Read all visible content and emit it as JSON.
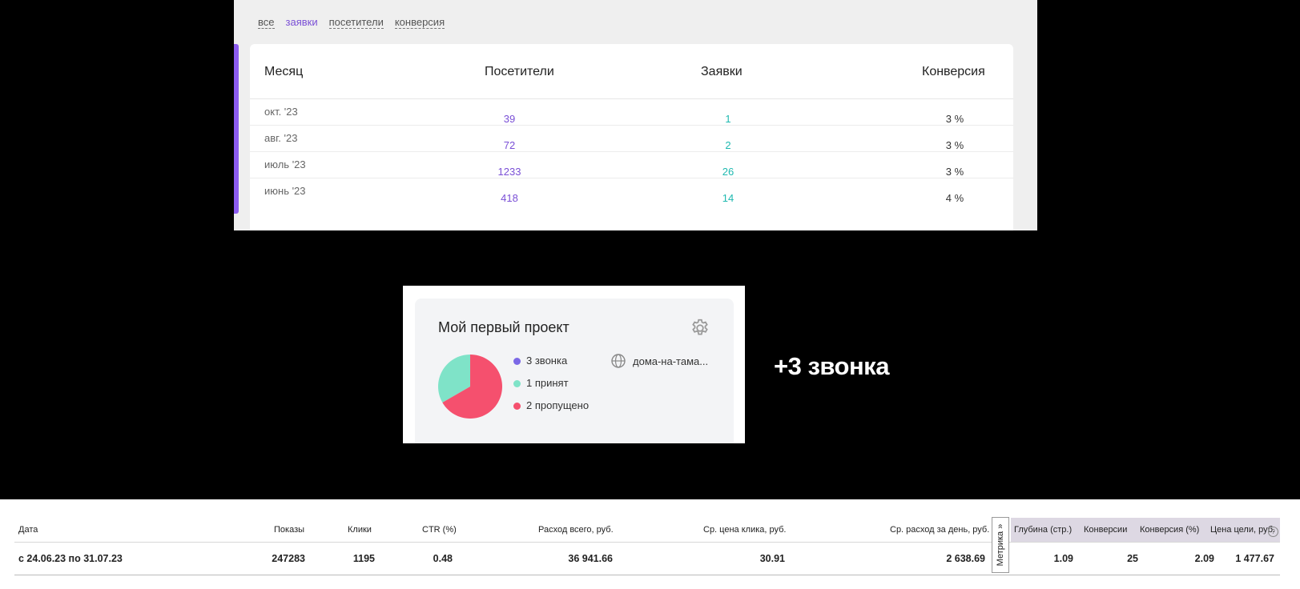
{
  "filters": [
    "все",
    "заявки",
    "посетители",
    "конверсия"
  ],
  "table": {
    "headers": {
      "month": "Месяц",
      "visitors": "Посетители",
      "applications": "Заявки",
      "conversion": "Конверсия"
    },
    "rows": [
      {
        "month": "окт. '23",
        "visitors": "39",
        "applications": "1",
        "conversion": "3 %"
      },
      {
        "month": "авг. '23",
        "visitors": "72",
        "applications": "2",
        "conversion": "3 %"
      },
      {
        "month": "июль '23",
        "visitors": "1233",
        "applications": "26",
        "conversion": "3 %"
      },
      {
        "month": "июнь '23",
        "visitors": "418",
        "applications": "14",
        "conversion": "4 %"
      }
    ]
  },
  "project": {
    "title": "Мой первый проект",
    "legend": [
      {
        "label": "3 звонка",
        "color": "#7b68e6"
      },
      {
        "label": "1 принят",
        "color": "#7fe3c8"
      },
      {
        "label": "2 пропущено",
        "color": "#f5506e"
      }
    ],
    "pie": {
      "accepted": 1,
      "missed": 2
    },
    "site": "дома-на-тама..."
  },
  "headline": "+3 звонка",
  "stats": {
    "headers": {
      "date": "Дата",
      "impressions": "Показы",
      "clicks": "Клики",
      "ctr": "CTR (%)",
      "spend": "Расход всего, руб.",
      "cpc": "Ср. цена клика, руб.",
      "daily": "Ср. расход за день, руб.",
      "depth": "Глубина (стр.)",
      "conversions": "Конверсии",
      "conv_rate": "Конверсия (%)",
      "goal_price": "Цена цели, руб."
    },
    "metrika": "Метрика »",
    "row": {
      "date": "с 24.06.23 по 31.07.23",
      "impressions": "247283",
      "clicks": "1195",
      "ctr": "0.48",
      "spend": "36 941.66",
      "cpc": "30.91",
      "daily": "2 638.69",
      "depth": "1.09",
      "conversions": "25",
      "conv_rate": "2.09",
      "goal_price": "1 477.67"
    }
  },
  "colors": {
    "accent": "#8c5cf0",
    "visitors": "#7a4fd6",
    "applications": "#1fb9b0"
  }
}
